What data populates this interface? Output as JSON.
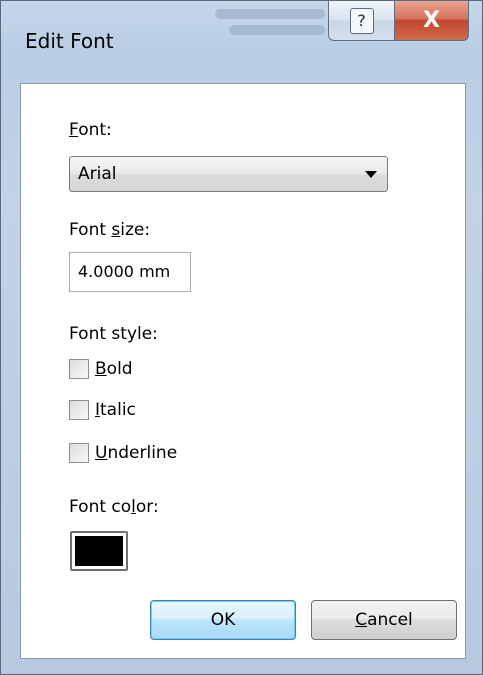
{
  "window": {
    "title": "Edit Font",
    "help_glyph": "?",
    "close_glyph": "X"
  },
  "font": {
    "label": "Font:",
    "selected": "Arial"
  },
  "font_size": {
    "label": "Font size:",
    "value": "4.0000 mm"
  },
  "font_style": {
    "label": "Font style:",
    "options": [
      {
        "label": "Bold",
        "checked": false
      },
      {
        "label": "Italic",
        "checked": false
      },
      {
        "label": "Underline",
        "checked": false
      }
    ]
  },
  "font_color": {
    "label": "Font color:",
    "color": "#000000"
  },
  "buttons": {
    "ok": "OK",
    "cancel": "Cancel"
  },
  "colors": {
    "accent": "#3c7fb1",
    "close": "#c2472d"
  },
  "icons": {
    "help": "help-icon",
    "close": "close-icon",
    "dropdown": "chevron-down-icon"
  }
}
